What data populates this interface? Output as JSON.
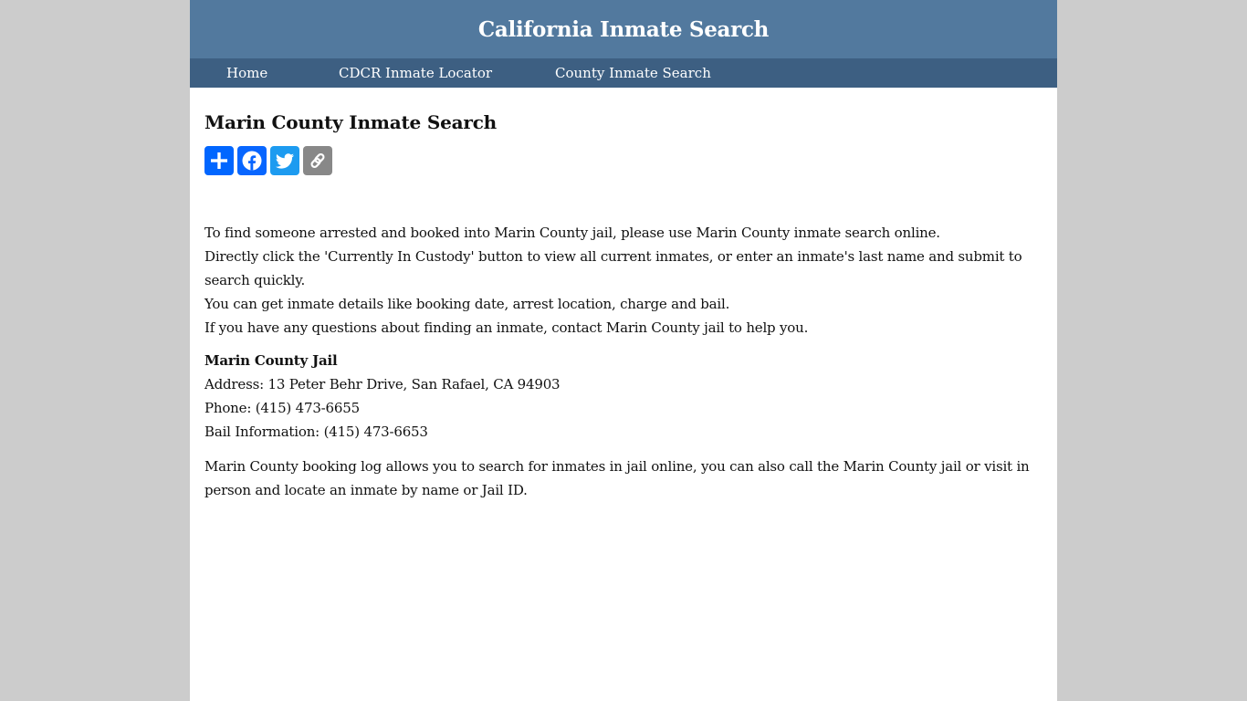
{
  "header": {
    "site_title": "California Inmate Search"
  },
  "nav": {
    "items": [
      {
        "label": "Home"
      },
      {
        "label": "CDCR Inmate Locator"
      },
      {
        "label": "County Inmate Search"
      }
    ]
  },
  "main": {
    "page_title": "Marin County Inmate Search",
    "share_buttons": [
      {
        "icon": "share-plus-icon",
        "label": "Share"
      },
      {
        "icon": "facebook-icon",
        "label": "Facebook"
      },
      {
        "icon": "twitter-icon",
        "label": "Twitter"
      },
      {
        "icon": "copy-link-icon",
        "label": "Copy Link"
      }
    ],
    "intro_lines": [
      "To find someone arrested and booked into Marin County jail, please use Marin County inmate search online.",
      "Directly click the 'Currently In Custody' button to view all current inmates, or enter an inmate's last name and submit to search quickly.",
      "You can get inmate details like booking date, arrest location, charge and bail.",
      "If you have any questions about finding an inmate, contact Marin County jail to help you."
    ],
    "jail": {
      "name": "Marin County Jail",
      "address": "Address: 13 Peter Behr Drive, San Rafael, CA 94903",
      "phone": "Phone: (415) 473-6655",
      "bail": "Bail Information: (415) 473-6653"
    },
    "closing": "Marin County booking log allows you to search for inmates in jail online, you can also call the Marin County jail or visit in person and locate an inmate by name or Jail ID."
  },
  "colors": {
    "header_bg": "#52799e",
    "nav_bg": "#3d5f82",
    "page_bg": "#cccccc",
    "share_blue": "#0166ff",
    "facebook_blue": "#0866ff",
    "twitter_blue": "#1d9bf0",
    "copy_gray": "#888888"
  }
}
